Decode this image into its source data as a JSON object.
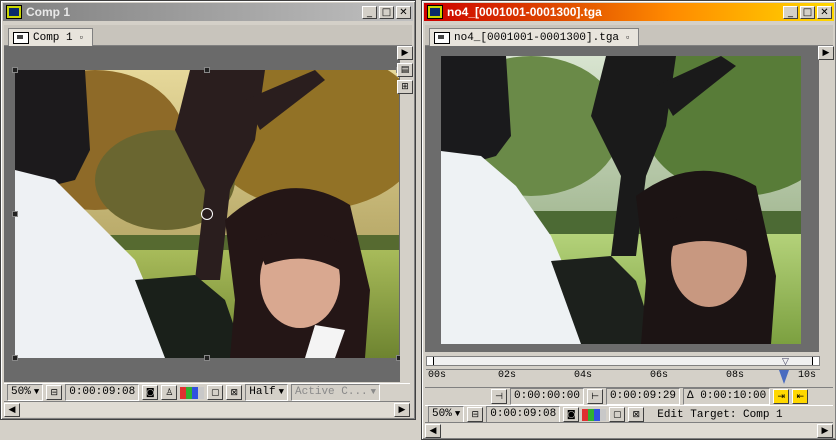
{
  "left_window": {
    "title": "Comp 1",
    "tab_label": "Comp 1",
    "zoom": "50%",
    "timecode": "0:00:09:08",
    "resolution": "Half",
    "camera_view": "Active C..."
  },
  "right_window": {
    "title": "no4_[0001001-0001300].tga",
    "tab_label": "no4_[0001001-0001300].tga",
    "ruler_ticks": [
      "00s",
      "02s",
      "04s",
      "06s",
      "08s",
      "10s"
    ],
    "in_point": "0:00:00:00",
    "out_point": "0:00:09:29",
    "duration": "Δ 0:00:10:00",
    "zoom": "50%",
    "timecode": "0:00:09:08",
    "edit_target": "Edit Target: Comp 1"
  },
  "icons": [
    "app-icon",
    "minimize-icon",
    "maximize-icon",
    "close-icon",
    "snapshot-icon",
    "color-channels-icon",
    "region-of-interest-icon",
    "transparency-grid-icon",
    "set-in-point-icon",
    "set-out-point-icon",
    "ripple-insert-icon",
    "overlay-edit-icon",
    "scroll-left-icon",
    "scroll-right-icon"
  ]
}
